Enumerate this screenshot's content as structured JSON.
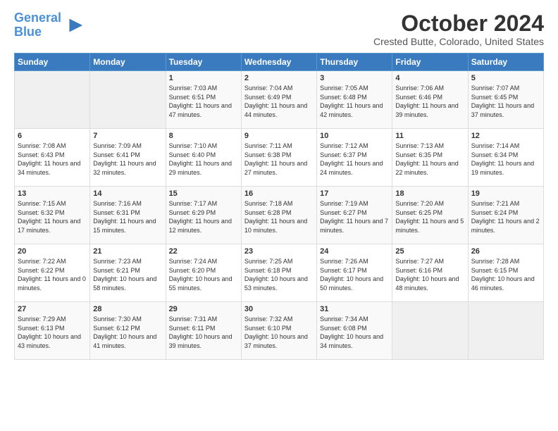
{
  "logo": {
    "line1": "General",
    "line2": "Blue"
  },
  "title": "October 2024",
  "location": "Crested Butte, Colorado, United States",
  "weekdays": [
    "Sunday",
    "Monday",
    "Tuesday",
    "Wednesday",
    "Thursday",
    "Friday",
    "Saturday"
  ],
  "weeks": [
    [
      {
        "day": "",
        "empty": true
      },
      {
        "day": "",
        "empty": true
      },
      {
        "day": "1",
        "sunrise": "7:03 AM",
        "sunset": "6:51 PM",
        "daylight": "11 hours and 47 minutes."
      },
      {
        "day": "2",
        "sunrise": "7:04 AM",
        "sunset": "6:49 PM",
        "daylight": "11 hours and 44 minutes."
      },
      {
        "day": "3",
        "sunrise": "7:05 AM",
        "sunset": "6:48 PM",
        "daylight": "11 hours and 42 minutes."
      },
      {
        "day": "4",
        "sunrise": "7:06 AM",
        "sunset": "6:46 PM",
        "daylight": "11 hours and 39 minutes."
      },
      {
        "day": "5",
        "sunrise": "7:07 AM",
        "sunset": "6:45 PM",
        "daylight": "11 hours and 37 minutes."
      }
    ],
    [
      {
        "day": "6",
        "sunrise": "7:08 AM",
        "sunset": "6:43 PM",
        "daylight": "11 hours and 34 minutes."
      },
      {
        "day": "7",
        "sunrise": "7:09 AM",
        "sunset": "6:41 PM",
        "daylight": "11 hours and 32 minutes."
      },
      {
        "day": "8",
        "sunrise": "7:10 AM",
        "sunset": "6:40 PM",
        "daylight": "11 hours and 29 minutes."
      },
      {
        "day": "9",
        "sunrise": "7:11 AM",
        "sunset": "6:38 PM",
        "daylight": "11 hours and 27 minutes."
      },
      {
        "day": "10",
        "sunrise": "7:12 AM",
        "sunset": "6:37 PM",
        "daylight": "11 hours and 24 minutes."
      },
      {
        "day": "11",
        "sunrise": "7:13 AM",
        "sunset": "6:35 PM",
        "daylight": "11 hours and 22 minutes."
      },
      {
        "day": "12",
        "sunrise": "7:14 AM",
        "sunset": "6:34 PM",
        "daylight": "11 hours and 19 minutes."
      }
    ],
    [
      {
        "day": "13",
        "sunrise": "7:15 AM",
        "sunset": "6:32 PM",
        "daylight": "11 hours and 17 minutes."
      },
      {
        "day": "14",
        "sunrise": "7:16 AM",
        "sunset": "6:31 PM",
        "daylight": "11 hours and 15 minutes."
      },
      {
        "day": "15",
        "sunrise": "7:17 AM",
        "sunset": "6:29 PM",
        "daylight": "11 hours and 12 minutes."
      },
      {
        "day": "16",
        "sunrise": "7:18 AM",
        "sunset": "6:28 PM",
        "daylight": "11 hours and 10 minutes."
      },
      {
        "day": "17",
        "sunrise": "7:19 AM",
        "sunset": "6:27 PM",
        "daylight": "11 hours and 7 minutes."
      },
      {
        "day": "18",
        "sunrise": "7:20 AM",
        "sunset": "6:25 PM",
        "daylight": "11 hours and 5 minutes."
      },
      {
        "day": "19",
        "sunrise": "7:21 AM",
        "sunset": "6:24 PM",
        "daylight": "11 hours and 2 minutes."
      }
    ],
    [
      {
        "day": "20",
        "sunrise": "7:22 AM",
        "sunset": "6:22 PM",
        "daylight": "11 hours and 0 minutes."
      },
      {
        "day": "21",
        "sunrise": "7:23 AM",
        "sunset": "6:21 PM",
        "daylight": "10 hours and 58 minutes."
      },
      {
        "day": "22",
        "sunrise": "7:24 AM",
        "sunset": "6:20 PM",
        "daylight": "10 hours and 55 minutes."
      },
      {
        "day": "23",
        "sunrise": "7:25 AM",
        "sunset": "6:18 PM",
        "daylight": "10 hours and 53 minutes."
      },
      {
        "day": "24",
        "sunrise": "7:26 AM",
        "sunset": "6:17 PM",
        "daylight": "10 hours and 50 minutes."
      },
      {
        "day": "25",
        "sunrise": "7:27 AM",
        "sunset": "6:16 PM",
        "daylight": "10 hours and 48 minutes."
      },
      {
        "day": "26",
        "sunrise": "7:28 AM",
        "sunset": "6:15 PM",
        "daylight": "10 hours and 46 minutes."
      }
    ],
    [
      {
        "day": "27",
        "sunrise": "7:29 AM",
        "sunset": "6:13 PM",
        "daylight": "10 hours and 43 minutes."
      },
      {
        "day": "28",
        "sunrise": "7:30 AM",
        "sunset": "6:12 PM",
        "daylight": "10 hours and 41 minutes."
      },
      {
        "day": "29",
        "sunrise": "7:31 AM",
        "sunset": "6:11 PM",
        "daylight": "10 hours and 39 minutes."
      },
      {
        "day": "30",
        "sunrise": "7:32 AM",
        "sunset": "6:10 PM",
        "daylight": "10 hours and 37 minutes."
      },
      {
        "day": "31",
        "sunrise": "7:34 AM",
        "sunset": "6:08 PM",
        "daylight": "10 hours and 34 minutes."
      },
      {
        "day": "",
        "empty": true
      },
      {
        "day": "",
        "empty": true
      }
    ]
  ],
  "labels": {
    "sunrise": "Sunrise:",
    "sunset": "Sunset:",
    "daylight": "Daylight:"
  }
}
